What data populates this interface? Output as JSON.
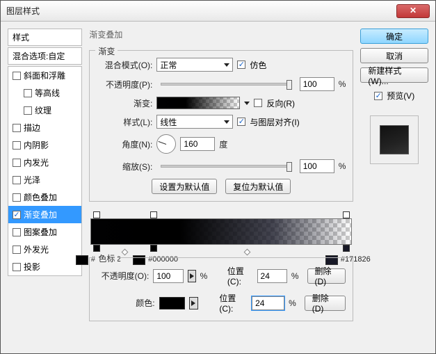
{
  "window": {
    "title": "图层样式"
  },
  "left": {
    "header": "样式",
    "selected": "混合选项:自定",
    "items": [
      {
        "label": "斜面和浮雕",
        "checked": false,
        "indent": false
      },
      {
        "label": "等高线",
        "checked": false,
        "indent": true
      },
      {
        "label": "纹理",
        "checked": false,
        "indent": true
      },
      {
        "label": "描边",
        "checked": false,
        "indent": false
      },
      {
        "label": "内阴影",
        "checked": false,
        "indent": false
      },
      {
        "label": "内发光",
        "checked": false,
        "indent": false
      },
      {
        "label": "光泽",
        "checked": false,
        "indent": false
      },
      {
        "label": "颜色叠加",
        "checked": false,
        "indent": false
      },
      {
        "label": "渐变叠加",
        "checked": true,
        "indent": false,
        "selected": true
      },
      {
        "label": "图案叠加",
        "checked": false,
        "indent": false
      },
      {
        "label": "外发光",
        "checked": false,
        "indent": false
      },
      {
        "label": "投影",
        "checked": false,
        "indent": false
      }
    ]
  },
  "center": {
    "section_title": "渐变叠加",
    "group_title": "渐变",
    "blend_label": "混合模式(O):",
    "blend_value": "正常",
    "dither_label": "仿色",
    "opacity_label": "不透明度(P):",
    "opacity_value": "100",
    "percent": "%",
    "gradient_label": "渐变:",
    "reverse_label": "反向(R)",
    "style_label": "样式(L):",
    "style_value": "线性",
    "align_label": "与图层对齐(I)",
    "angle_label": "角度(N):",
    "angle_value": "160",
    "degree": "度",
    "scale_label": "缩放(S):",
    "scale_value": "100",
    "defaults_set": "设置为默认值",
    "defaults_reset": "复位为默认值"
  },
  "editor": {
    "stops": [
      {
        "pos": 2,
        "color": "#010102",
        "label": "#010102"
      },
      {
        "pos": 24,
        "color": "#000000",
        "label": "#000000"
      },
      {
        "pos": 98,
        "color": "#171826",
        "label": "#171826"
      }
    ],
    "group_title": "色标",
    "stop_opacity_label": "不透明度(O):",
    "stop_opacity_value": "100",
    "pos_label": "位置(C):",
    "pos_value_top": "24",
    "pos_value_bottom": "24",
    "percent": "%",
    "delete_label": "删除(D)",
    "color_label": "颜色:",
    "color_value": "#000000"
  },
  "right": {
    "ok": "确定",
    "cancel": "取消",
    "new_style": "新建样式(W)...",
    "preview_label": "预览(V)"
  }
}
